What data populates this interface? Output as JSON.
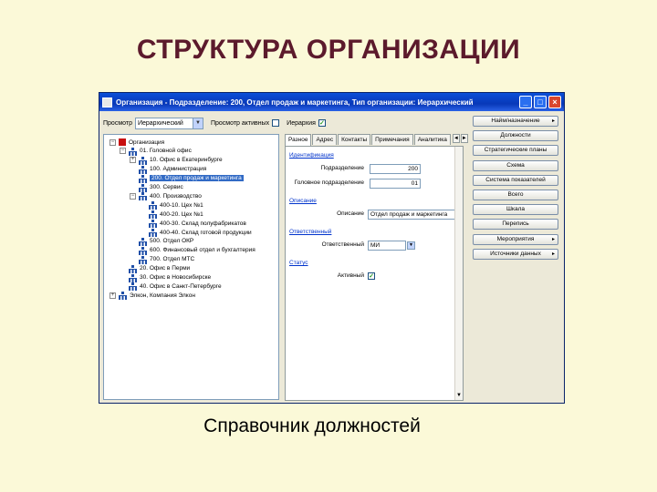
{
  "slide": {
    "title": "СТРУКТУРА ОРГАНИЗАЦИИ",
    "caption": "Справочник должностей"
  },
  "window": {
    "title": "Организация - Подразделение: 200, Отдел продаж и маркетинга, Тип организации: Иерархический",
    "buttons": {
      "minimize": "_",
      "maximize": "□",
      "close": "×"
    }
  },
  "toolbar": {
    "view_label": "Просмотр",
    "view_value": "Иерархический",
    "view_active_label": "Просмотр активных",
    "hierarchy_label": "Иерархия",
    "hierarchy_checked": "✓"
  },
  "tree": [
    {
      "label": "Организация",
      "expander": "−",
      "root": true,
      "level": 0
    },
    {
      "label": "01. Головной офис",
      "expander": "−",
      "level": 1
    },
    {
      "label": "10. Офис в Екатеринбурге",
      "expander": "+",
      "level": 2
    },
    {
      "label": "100. Администрация",
      "expander": "",
      "level": 2
    },
    {
      "label": "200. Отдел продаж и маркетинга",
      "expander": "",
      "level": 2,
      "selected": true
    },
    {
      "label": "300. Сервис",
      "expander": "",
      "level": 2
    },
    {
      "label": "400. Производство",
      "expander": "−",
      "level": 2
    },
    {
      "label": "400-10. Цех №1",
      "expander": "",
      "level": 3
    },
    {
      "label": "400-20. Цех №1",
      "expander": "",
      "level": 3
    },
    {
      "label": "400-30. Склад полуфабрикатов",
      "expander": "",
      "level": 3
    },
    {
      "label": "400-40. Склад готовой продукции",
      "expander": "",
      "level": 3
    },
    {
      "label": "500. Отдел ОКР",
      "expander": "",
      "level": 2
    },
    {
      "label": "600. Финансовый отдел и бухгалтерия",
      "expander": "",
      "level": 2
    },
    {
      "label": "700. Отдел МТС",
      "expander": "",
      "level": 2
    },
    {
      "label": "20. Офис в Перми",
      "expander": "",
      "level": 1
    },
    {
      "label": "30. Офис в Новосибирске",
      "expander": "",
      "level": 1
    },
    {
      "label": "40. Офис в Санкт-Петербурге",
      "expander": "",
      "level": 1
    },
    {
      "label": "Элкон, Компания Элкон",
      "expander": "+",
      "level": 0
    }
  ],
  "tabs": [
    "Разное",
    "Адрес",
    "Контакты",
    "Примечания",
    "Аналитика"
  ],
  "tab_arrows": {
    "left": "◄",
    "right": "►"
  },
  "details": {
    "sections": {
      "identification": "Идентификация",
      "description": "Описание",
      "responsible": "Ответственный",
      "status": "Статус"
    },
    "fields": {
      "subdivision_label": "Подразделение",
      "subdivision_value": "200",
      "head_label": "Головное подразделение",
      "head_value": "01",
      "description_label": "Описание",
      "description_value": "Отдел продаж и маркетинга",
      "responsible_label": "Ответственный",
      "responsible_value": "МИ",
      "active_label": "Активный",
      "active_checked": "✓"
    }
  },
  "side_buttons": [
    {
      "label": "Найм/назначение",
      "arrow": "▸"
    },
    {
      "label": "Должности",
      "arrow": ""
    },
    {
      "label": "Стратегические планы",
      "arrow": ""
    },
    {
      "label": "Схема",
      "arrow": ""
    },
    {
      "label": "Система показателей",
      "arrow": ""
    },
    {
      "label": "Всего",
      "arrow": ""
    },
    {
      "label": "Шкала",
      "arrow": ""
    },
    {
      "label": "Перепись",
      "arrow": ""
    },
    {
      "label": "Мероприятия",
      "arrow": "▸"
    },
    {
      "label": "Источники данных",
      "arrow": "▸"
    }
  ]
}
